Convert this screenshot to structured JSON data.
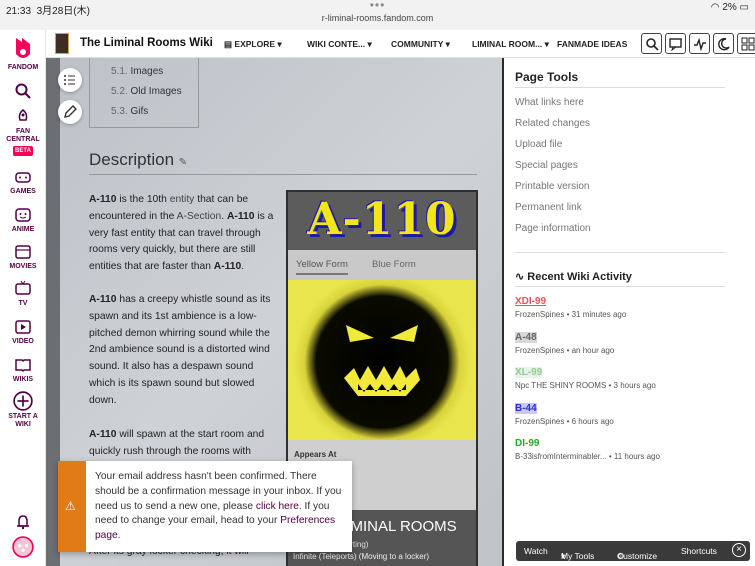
{
  "status": {
    "time": "21:33",
    "date": "3月28日(木)",
    "url": "r-liminal-rooms.fandom.com",
    "battery": "2%"
  },
  "rail": {
    "brand": "FANDOM",
    "fan_central": "FAN CENTRAL",
    "beta": "BETA",
    "games": "GAMES",
    "anime": "ANIME",
    "movies": "MOVIES",
    "tv": "TV",
    "video": "VIDEO",
    "wikis": "WIKIS",
    "start_wiki": "START A WIKI"
  },
  "nav": {
    "wiki_title": "The Liminal Rooms Wiki",
    "explore": "EXPLORE",
    "wiki_content": "WIKI CONTE...",
    "community": "COMMUNITY",
    "liminal_room": "LIMINAL ROOM...",
    "fanmade": "FANMADE IDEAS"
  },
  "toc": {
    "items": [
      {
        "num": "5.1.",
        "label": "Images"
      },
      {
        "num": "5.2.",
        "label": "Old Images"
      },
      {
        "num": "5.3.",
        "label": "Gifs"
      }
    ]
  },
  "article": {
    "heading": "Description",
    "p1_a": "A-110",
    "p1_b": " is the 10th ",
    "p1_link1": "entity",
    "p1_c": " that can be encountered in the ",
    "p1_link2": "A-Section",
    "p1_d": ". ",
    "p1_e": "A-110",
    "p1_f": " is a very fast entity that can travel through rooms very quickly, but there are still entities that are faster than ",
    "p1_g": "A-110",
    "p1_h": ".",
    "p2_a": "A-110",
    "p2_b": " has a creepy whistle sound as its spawn and its 1st ambience is a low-pitched demon whirring sound while the 2nd ambience sound is a distorted wind sound. It also has a despawn sound which is its spawn sound but slowed down.",
    "p3_a": "A-110",
    "p3_b": " will spawn at the start room and quickly rush through the rooms with",
    "p4": "After its gray locker checking, it will"
  },
  "infobox": {
    "title": "A-110",
    "tab1": "Yellow Form",
    "tab2": "Blue Form",
    "appears_label": "Appears At",
    "footer_title": "LIMINAL ROOMS",
    "footer_line1": "(Teleporting)",
    "footer_line2": "Infinite (Teleports) (Moving to a locker)"
  },
  "toast": {
    "text1": "Your email address hasn't been confirmed. There should be a confirmation message in your inbox. If you need us to send a new one, please ",
    "link1": "click here",
    "text2": ". If you need to change your email, head to your ",
    "link2": "Preferences page",
    "text3": "."
  },
  "page_tools": {
    "title": "Page Tools",
    "links": [
      "What links here",
      "Related changes",
      "Upload file",
      "Special pages",
      "Printable version",
      "Permanent link",
      "Page information"
    ]
  },
  "activity": {
    "title": "Recent Wiki Activity",
    "items": [
      {
        "title": "XDI-99",
        "meta": "FrozenSpines • 31 minutes ago",
        "color": "#e8505b"
      },
      {
        "title": "A-48",
        "meta": "FrozenSpines • an hour ago",
        "color": "#666666"
      },
      {
        "title": "XL-99",
        "meta": "Npc THE SHINY ROOMS • 3 hours ago",
        "color": "#8fcf8f"
      },
      {
        "title": "B-44",
        "meta": "FrozenSpines • 6 hours ago",
        "color": "#2b2bd8"
      },
      {
        "title": "DI-99",
        "meta": "B-33isfromInterminabler... • 11 hours ago",
        "color": "#22aa22"
      }
    ]
  },
  "bottombar": {
    "watch": "Watch",
    "my_tools": "My Tools",
    "customize": "Customize",
    "shortcuts": "Shortcuts"
  },
  "colors": {
    "brand": "#fa005a",
    "rail_text": "#520044",
    "toast_accent": "#e07b15"
  }
}
